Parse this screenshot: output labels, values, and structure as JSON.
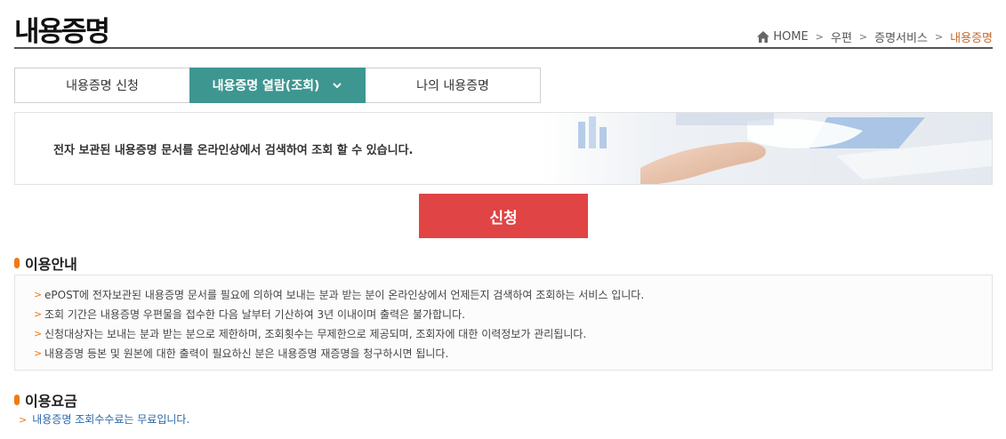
{
  "page": {
    "title": "내용증명"
  },
  "breadcrumb": {
    "home": "HOME",
    "items": [
      "우편",
      "증명서비스"
    ],
    "current": "내용증명"
  },
  "tabs": [
    {
      "label": "내용증명 신청",
      "active": false
    },
    {
      "label": "내용증명 열람(조회)",
      "active": true
    },
    {
      "label": "나의 내용증명",
      "active": false
    }
  ],
  "banner": {
    "text": "전자 보관된 내용증명 문서를 온라인상에서 검색하여 조회 할 수 있습니다."
  },
  "apply_button": {
    "label": "신청"
  },
  "usage_guide": {
    "heading": "이용안내",
    "items": [
      "ePOST에 전자보관된 내용증명 문서를 필요에 의하여 보내는 분과 받는 분이 온라인상에서 언제든지 검색하여 조회하는 서비스 입니다.",
      "조회 기간은 내용증명 우편물을 접수한 다음 날부터 기산하여 3년 이내이며 출력은 불가합니다.",
      "신청대상자는 보내는 분과 받는 분으로 제한하며, 조회횟수는 무제한으로 제공되며, 조회자에 대한 이력정보가 관리됩니다.",
      "내용증명 등본 및 원본에 대한 출력이 필요하신 분은 내용증명 재증명을 청구하시면 됩니다."
    ]
  },
  "usage_fee": {
    "heading": "이용요금",
    "text": "내용증명 조회수수료는 무료입니다."
  },
  "colors": {
    "accent_tab": "#3e9690",
    "apply_button": "#e04444",
    "section_mark": "#ef7b13",
    "breadcrumb_current": "#c46a2a",
    "fee_text": "#2b66a8"
  }
}
